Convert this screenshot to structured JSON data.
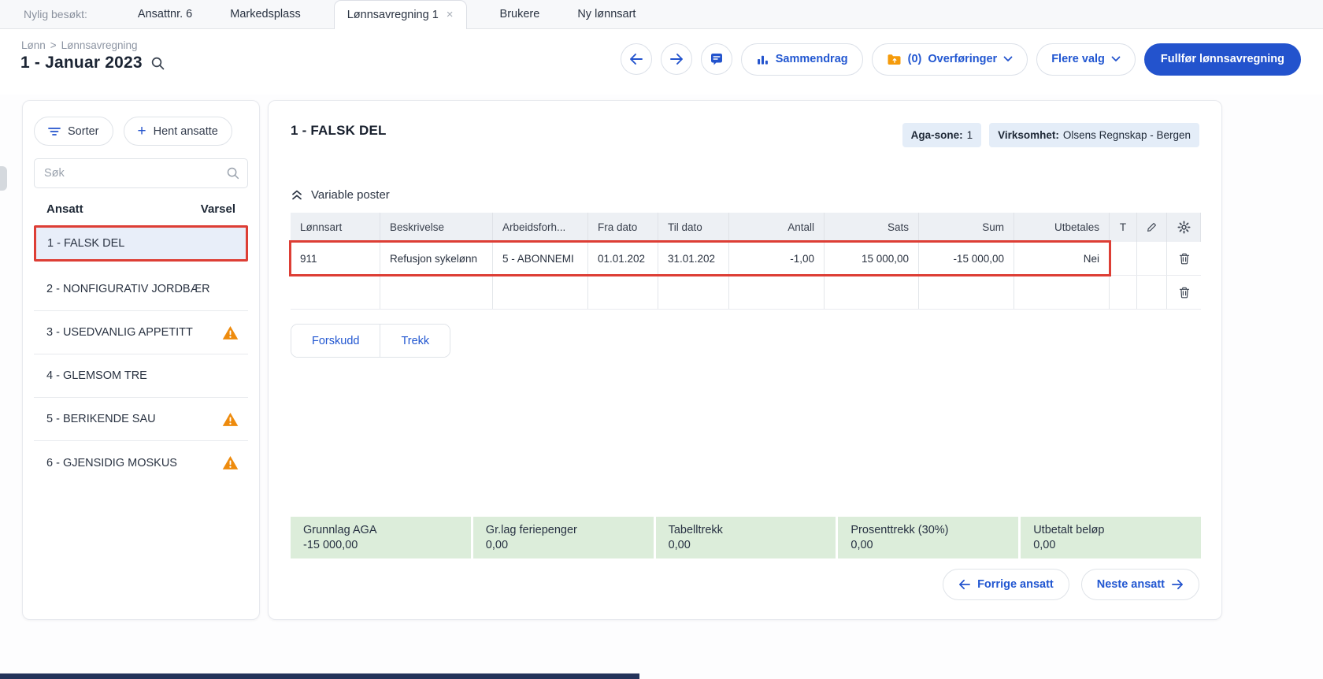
{
  "icons": {
    "close": "×",
    "plus": "+"
  },
  "colors": {
    "accent_blue": "#2353cd",
    "warning_orange": "#ee8b0d",
    "annotation_red": "#dd3e35",
    "selected_row_bg": "#e8eef9",
    "badge_bg": "#e4edf8",
    "summary_green": "#dcedda",
    "folder_orange": "#f59b0b"
  },
  "tabbar": {
    "recent_label": "Nylig besøkt:",
    "tabs": [
      {
        "label": "Ansattnr. 6"
      },
      {
        "label": "Markedsplass"
      },
      {
        "label": "Lønnsavregning 1"
      },
      {
        "label": "Brukere"
      },
      {
        "label": "Ny lønnsart"
      }
    ]
  },
  "header": {
    "breadcrumb": {
      "section": "Lønn",
      "separator": ">",
      "page": "Lønnsavregning"
    },
    "title": "1 - Januar 2023",
    "actions": {
      "sammendrag": "Sammendrag",
      "overforinger_count": "(0)",
      "overforinger": "Overføringer",
      "flere_valg": "Flere valg",
      "fullfor": "Fullfør lønnsavregning"
    }
  },
  "sidebar": {
    "sorter_label": "Sorter",
    "hent_ansatte_label": "Hent ansatte",
    "search_placeholder": "Søk",
    "columns": {
      "ansatt": "Ansatt",
      "varsel": "Varsel"
    },
    "employees": [
      {
        "name": "1 - FALSK DEL",
        "selected": true,
        "warning": false
      },
      {
        "name": "2 - NONFIGURATIV JORDBÆR",
        "selected": false,
        "warning": false
      },
      {
        "name": "3 - USEDVANLIG APPETITT",
        "selected": false,
        "warning": true
      },
      {
        "name": "4 - GLEMSOM TRE",
        "selected": false,
        "warning": false
      },
      {
        "name": "5 - BERIKENDE SAU",
        "selected": false,
        "warning": true
      },
      {
        "name": "6 - GJENSIDIG MOSKUS",
        "selected": false,
        "warning": true
      }
    ]
  },
  "main": {
    "employee_title": "1 - FALSK DEL",
    "badges": {
      "aga_label": "Aga-sone:",
      "aga_value": "1",
      "virksomhet_label": "Virksomhet:",
      "virksomhet_value": "Olsens Regnskap - Bergen"
    },
    "section_title": "Variable poster",
    "table": {
      "headers": [
        "Lønnsart",
        "Beskrivelse",
        "Arbeidsforh...",
        "Fra dato",
        "Til dato",
        "Antall",
        "Sats",
        "Sum",
        "Utbetales",
        "T"
      ],
      "rows": [
        {
          "lonnsart": "911",
          "beskrivelse": "Refusjon sykelønn",
          "arbeidsforhold": "5 - ABONNEMI",
          "fra_dato": "01.01.202",
          "til_dato": "31.01.202",
          "antall": "-1,00",
          "sats": "15 000,00",
          "sum": "-15 000,00",
          "utbetales": "Nei"
        }
      ]
    },
    "buttons": {
      "forskudd": "Forskudd",
      "trekk": "Trekk"
    },
    "summary": [
      {
        "label": "Grunnlag AGA",
        "value": "-15 000,00"
      },
      {
        "label": "Gr.lag feriepenger",
        "value": "0,00"
      },
      {
        "label": "Tabelltrekk",
        "value": "0,00"
      },
      {
        "label": "Prosenttrekk (30%)",
        "value": "0,00"
      },
      {
        "label": "Utbetalt beløp",
        "value": "0,00"
      }
    ],
    "nav": {
      "prev": "Forrige ansatt",
      "next": "Neste ansatt"
    }
  }
}
